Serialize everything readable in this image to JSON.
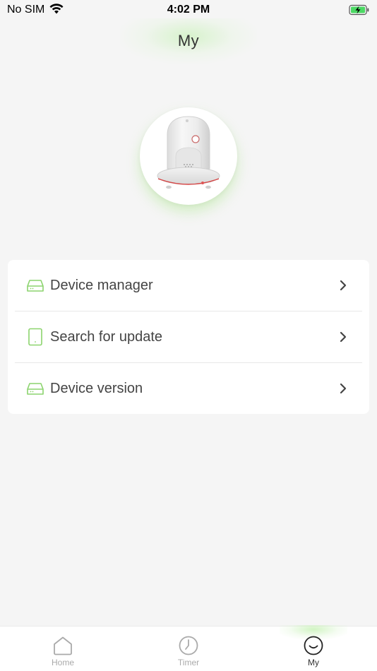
{
  "status_bar": {
    "carrier": "No SIM",
    "time": "4:02 PM",
    "wifi_icon": "wifi-icon",
    "battery_icon": "battery-charging-icon"
  },
  "header": {
    "title": "My"
  },
  "device": {
    "image_icon": "air-fryer-image"
  },
  "menu": {
    "items": [
      {
        "label": "Device manager",
        "icon": "hard-drive-icon"
      },
      {
        "label": "Search for update",
        "icon": "tablet-icon"
      },
      {
        "label": "Device version",
        "icon": "hard-drive-icon"
      }
    ]
  },
  "tab_bar": {
    "tabs": [
      {
        "label": "Home",
        "icon": "home-icon",
        "active": false
      },
      {
        "label": "Timer",
        "icon": "clock-icon",
        "active": false
      },
      {
        "label": "My",
        "icon": "smile-icon",
        "active": true
      }
    ]
  },
  "colors": {
    "accent": "#8cd46e",
    "background": "#f5f5f5",
    "card": "#ffffff"
  }
}
